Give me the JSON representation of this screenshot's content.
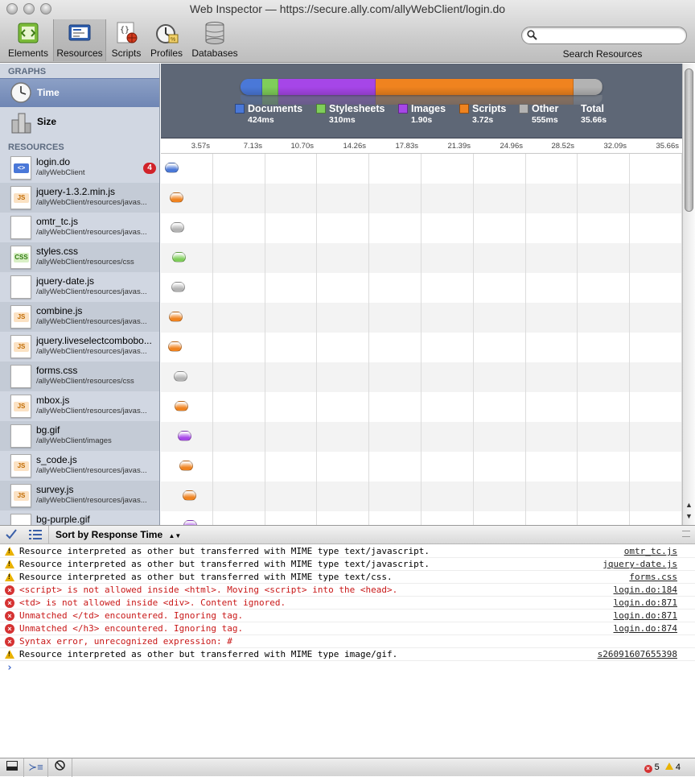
{
  "window": {
    "title": "Web Inspector — https://secure.ally.com/allyWebClient/login.do"
  },
  "toolbar": {
    "items": [
      {
        "label": "Elements",
        "icon": "elements-icon"
      },
      {
        "label": "Resources",
        "icon": "resources-icon",
        "selected": true
      },
      {
        "label": "Scripts",
        "icon": "scripts-icon"
      },
      {
        "label": "Profiles",
        "icon": "profiles-icon"
      },
      {
        "label": "Databases",
        "icon": "databases-icon"
      }
    ],
    "search_placeholder": "",
    "search_caption": "Search Resources"
  },
  "sidebar": {
    "graphs_header": "GRAPHS",
    "graphs": [
      {
        "label": "Time",
        "selected": true
      },
      {
        "label": "Size"
      }
    ],
    "resources_header": "RESOURCES",
    "resources": [
      {
        "name": "login.do",
        "path": "/allyWebClient",
        "kind": "document",
        "badge": "4"
      },
      {
        "name": "jquery-1.3.2.min.js",
        "path": "/allyWebClient/resources/javas...",
        "kind": "script"
      },
      {
        "name": "omtr_tc.js",
        "path": "/allyWebClient/resources/javas...",
        "kind": "other"
      },
      {
        "name": "styles.css",
        "path": "/allyWebClient/resources/css",
        "kind": "stylesheet"
      },
      {
        "name": "jquery-date.js",
        "path": "/allyWebClient/resources/javas...",
        "kind": "other"
      },
      {
        "name": "combine.js",
        "path": "/allyWebClient/resources/javas...",
        "kind": "script"
      },
      {
        "name": "jquery.liveselectcombobo...",
        "path": "/allyWebClient/resources/javas...",
        "kind": "script"
      },
      {
        "name": "forms.css",
        "path": "/allyWebClient/resources/css",
        "kind": "other"
      },
      {
        "name": "mbox.js",
        "path": "/allyWebClient/resources/javas...",
        "kind": "script"
      },
      {
        "name": "bg.gif",
        "path": "/allyWebClient/images",
        "kind": "image"
      },
      {
        "name": "s_code.js",
        "path": "/allyWebClient/resources/javas...",
        "kind": "script"
      },
      {
        "name": "survey.js",
        "path": "/allyWebClient/resources/javas...",
        "kind": "script"
      },
      {
        "name": "bg-purple.gif",
        "path": "",
        "kind": "image"
      }
    ]
  },
  "summary_graph": {
    "colors": {
      "Documents": "#4a78d8",
      "Stylesheets": "#7fce5a",
      "Images": "#a646e8",
      "Scripts": "#f0831f",
      "Other": "#b3b3b3"
    },
    "legend": [
      {
        "name": "Documents",
        "value": "424ms"
      },
      {
        "name": "Stylesheets",
        "value": "310ms"
      },
      {
        "name": "Images",
        "value": "1.90s"
      },
      {
        "name": "Scripts",
        "value": "3.72s"
      },
      {
        "name": "Other",
        "value": "555ms"
      },
      {
        "name": "Total",
        "value": "35.66s"
      }
    ],
    "bar_fractions": {
      "Documents": 0.06,
      "Stylesheets": 0.044,
      "Images": 0.27,
      "Scripts": 0.545,
      "Other": 0.081
    }
  },
  "timeline": {
    "ticks": [
      "3.57s",
      "7.13s",
      "10.70s",
      "14.26s",
      "17.83s",
      "21.39s",
      "24.96s",
      "28.52s",
      "32.09s",
      "35.66s"
    ],
    "start_times_s": [
      0.1,
      0.45,
      0.5,
      0.6,
      0.55,
      0.4,
      0.35,
      0.7,
      0.75,
      1.0,
      1.1,
      1.3,
      1.35
    ]
  },
  "console": {
    "sort_label": "Sort by Response Time",
    "messages": [
      {
        "level": "warning",
        "text": "Resource interpreted as other but transferred with MIME type text/javascript.",
        "source": "omtr_tc.js"
      },
      {
        "level": "warning",
        "text": "Resource interpreted as other but transferred with MIME type text/javascript.",
        "source": "jquery-date.js"
      },
      {
        "level": "warning",
        "text": "Resource interpreted as other but transferred with MIME type text/css.",
        "source": "forms.css"
      },
      {
        "level": "error",
        "text": "<script> is not allowed inside <html>. Moving <script> into the <head>.",
        "source": "login.do:184"
      },
      {
        "level": "error",
        "text": "<td> is not allowed inside <div>. Content ignored.",
        "source": "login.do:871"
      },
      {
        "level": "error",
        "text": "Unmatched </td> encountered.  Ignoring tag.",
        "source": "login.do:871"
      },
      {
        "level": "error",
        "text": "Unmatched </h3> encountered.  Ignoring tag.",
        "source": "login.do:874"
      },
      {
        "level": "error",
        "text": "Syntax error, unrecognized expression: #",
        "source": ""
      },
      {
        "level": "warning",
        "text": "Resource interpreted as other but transferred with MIME type image/gif.",
        "source": "s26091607655398"
      }
    ],
    "prompt": "›"
  },
  "status": {
    "errors": "5",
    "warnings": "4"
  }
}
